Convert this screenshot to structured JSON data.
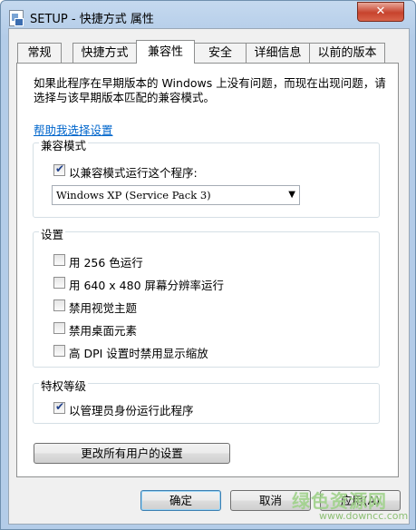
{
  "window": {
    "title": "SETUP - 快捷方式 属性",
    "close_label": "✕"
  },
  "tabs": [
    {
      "label": "常规",
      "active": false
    },
    {
      "label": "快捷方式",
      "active": false
    },
    {
      "label": "兼容性",
      "active": true
    },
    {
      "label": "安全",
      "active": false
    },
    {
      "label": "详细信息",
      "active": false
    },
    {
      "label": "以前的版本",
      "active": false
    }
  ],
  "compat": {
    "description": "如果此程序在早期版本的 Windows 上没有问题，而现在出现问题，请选择与该早期版本匹配的兼容模式。",
    "help_link": "帮助我选择设置",
    "mode_group": {
      "title": "兼容模式",
      "checkbox_label": "以兼容模式运行这个程序:",
      "checked": true,
      "selected_os": "Windows XP (Service Pack 3)"
    },
    "settings_group": {
      "title": "设置",
      "items": [
        {
          "label": "用 256 色运行",
          "checked": false
        },
        {
          "label": "用 640 x 480 屏幕分辨率运行",
          "checked": false
        },
        {
          "label": "禁用视觉主题",
          "checked": false
        },
        {
          "label": "禁用桌面元素",
          "checked": false
        },
        {
          "label": "高 DPI 设置时禁用显示缩放",
          "checked": false
        }
      ]
    },
    "privilege_group": {
      "title": "特权等级",
      "checkbox_label": "以管理员身份运行此程序",
      "checked": true
    },
    "all_users_button": "更改所有用户的设置"
  },
  "footer": {
    "ok": "确定",
    "cancel": "取消",
    "apply": "应用(A)"
  },
  "watermark": {
    "main": "绿色资源网",
    "sub": "www.downcc.com"
  }
}
